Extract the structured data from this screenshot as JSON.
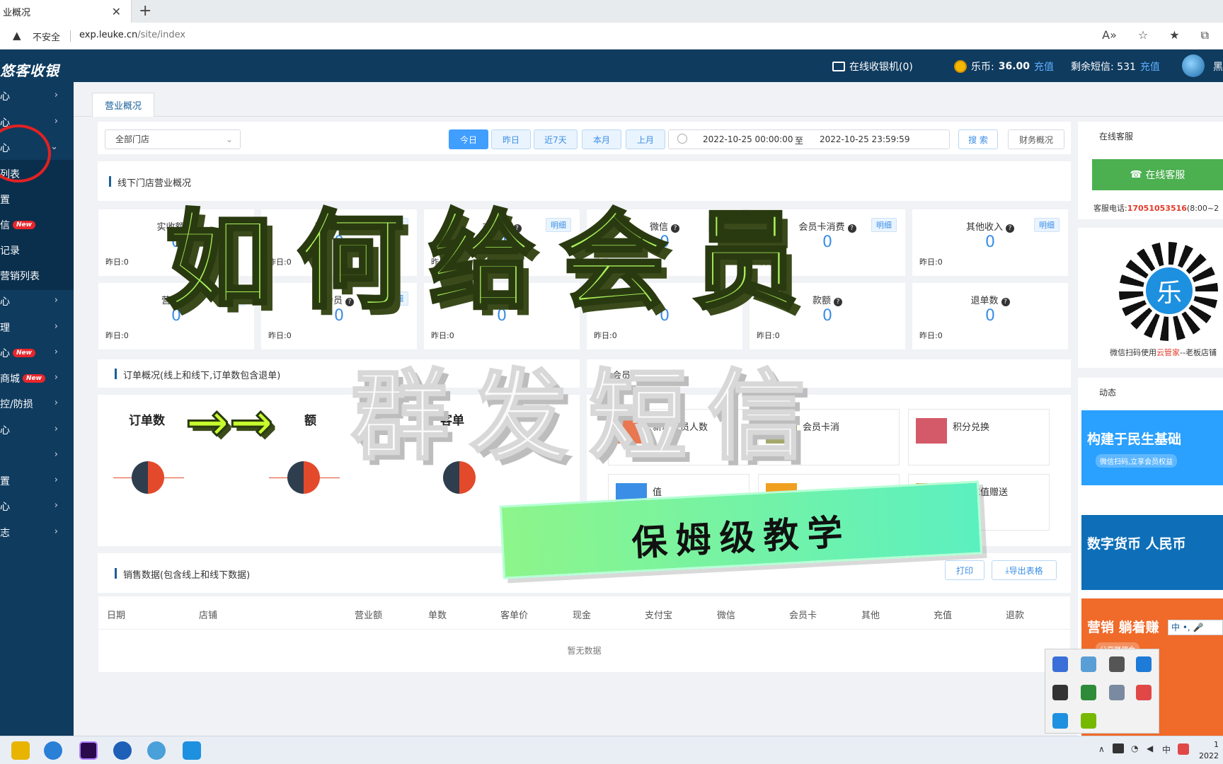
{
  "browser": {
    "tab_title": "业概况",
    "insecure_label": "不安全",
    "url_host": "exp.leuke.cn",
    "url_path": "/site/index"
  },
  "header": {
    "logo": "悠客收银",
    "online_cashier": "在线收银机(0)",
    "coin_label": "乐币:",
    "coin_value": "36.00",
    "recharge": "充值",
    "sms_label": "剩余短信: 531",
    "sms_recharge": "充值",
    "user": "黑"
  },
  "sidebar": {
    "items": [
      {
        "label": "心"
      },
      {
        "label": "心"
      },
      {
        "label": "心"
      },
      {
        "label": "列表"
      },
      {
        "label": "置"
      },
      {
        "label": "信",
        "badge": "New"
      },
      {
        "label": "记录"
      },
      {
        "label": "营销列表"
      },
      {
        "label": "心"
      },
      {
        "label": "理"
      },
      {
        "label": "心",
        "badge": "New"
      },
      {
        "label": "商城",
        "badge": "New"
      },
      {
        "label": "控/防损"
      },
      {
        "label": "心"
      },
      {
        "label": ""
      },
      {
        "label": "置"
      },
      {
        "label": "心"
      },
      {
        "label": "志"
      }
    ]
  },
  "page_tab": "营业概况",
  "filter": {
    "store": "全部门店",
    "buttons": [
      "今日",
      "昨日",
      "近7天",
      "本月",
      "上月"
    ],
    "active": "今日",
    "date_from": "2022-10-25 00:00:00",
    "date_to_label": "至",
    "date_to": "2022-10-25 23:59:59",
    "search": "搜 索",
    "finance": "财务概况"
  },
  "offline_title": "线下门店营业概况",
  "stats_row1": [
    {
      "label": "实收额",
      "value": "0",
      "yesterday": "昨日:0",
      "detail": ""
    },
    {
      "label": "现金收入",
      "value": "0",
      "yesterday": "昨日:0",
      "detail": "明细"
    },
    {
      "label": "支付宝",
      "value": "0",
      "yesterday": "昨日:0",
      "detail": "明细"
    },
    {
      "label": "微信",
      "value": "0",
      "yesterday": "昨日:0",
      "detail": "明细"
    },
    {
      "label": "会员卡消费",
      "value": "0",
      "yesterday": "昨日:0",
      "detail": "明细"
    },
    {
      "label": "其他收入",
      "value": "0",
      "yesterday": "昨日:0",
      "detail": "明细"
    }
  ],
  "stats_row2": [
    {
      "label": "营业",
      "value": "0",
      "yesterday": "昨日:0",
      "detail": "明细"
    },
    {
      "label": "会员",
      "value": "0",
      "yesterday": "昨日:0",
      "detail": "明细"
    },
    {
      "label": "订单数",
      "value": "0",
      "yesterday": "昨日:0",
      "detail": ""
    },
    {
      "label": "",
      "value": "0",
      "yesterday": "昨日:0",
      "detail": ""
    },
    {
      "label": "款额",
      "value": "0",
      "yesterday": "昨日:0",
      "detail": ""
    },
    {
      "label": "退单数",
      "value": "0",
      "yesterday": "昨日:0",
      "detail": ""
    }
  ],
  "order_title": "订单概况(线上和线下,订单数包含退单)",
  "order_labels": [
    "订单数",
    "额",
    "客单"
  ],
  "member_title": "会员概况",
  "member_cards": [
    "新增会员人数",
    "会员卡消",
    "积分兑换",
    "值",
    "",
    "会员充值赠送"
  ],
  "member_colors": [
    "#e9774f",
    "#a4a86a",
    "#d45a6a",
    "#3a8ee6",
    "#f0a020",
    "#d89a3a"
  ],
  "sales_title": "销售数据(包含线上和线下数据)",
  "print": "打印",
  "export": "导出表格",
  "table_headers": [
    "日期",
    "店铺",
    "营业额",
    "单数",
    "客单价",
    "现金",
    "支付宝",
    "微信",
    "会员卡",
    "其他",
    "充值",
    "退款"
  ],
  "no_data": "暂无数据",
  "service": {
    "title": "在线客服",
    "button": "在线客服",
    "phone_label": "客服电话:",
    "phone": "17051053516",
    "phone_hours": "(8:00~2",
    "qr_caption_a": "微信扫码使用",
    "qr_caption_b": "云管家",
    "qr_caption_c": "--老板店铺"
  },
  "news_title": "动态",
  "banners": [
    {
      "title": "构建于民生基础",
      "sub": "微信扫码,立享会员权益",
      "color": "#2aa0ff"
    },
    {
      "title": "数字货币 人民币",
      "sub": "",
      "color": "#0e6fb8"
    },
    {
      "title": "营销 躺着赚",
      "sub": "分享赚佣金",
      "color": "#f06a2a"
    }
  ],
  "overlay": {
    "title": "如何给会员",
    "arrow": "→→",
    "sub": "群发短信",
    "tag": "保姆级教学"
  },
  "ime": "中 •, 🎤",
  "taskbar": {
    "clock_top": "1",
    "clock_bottom": "2022"
  }
}
